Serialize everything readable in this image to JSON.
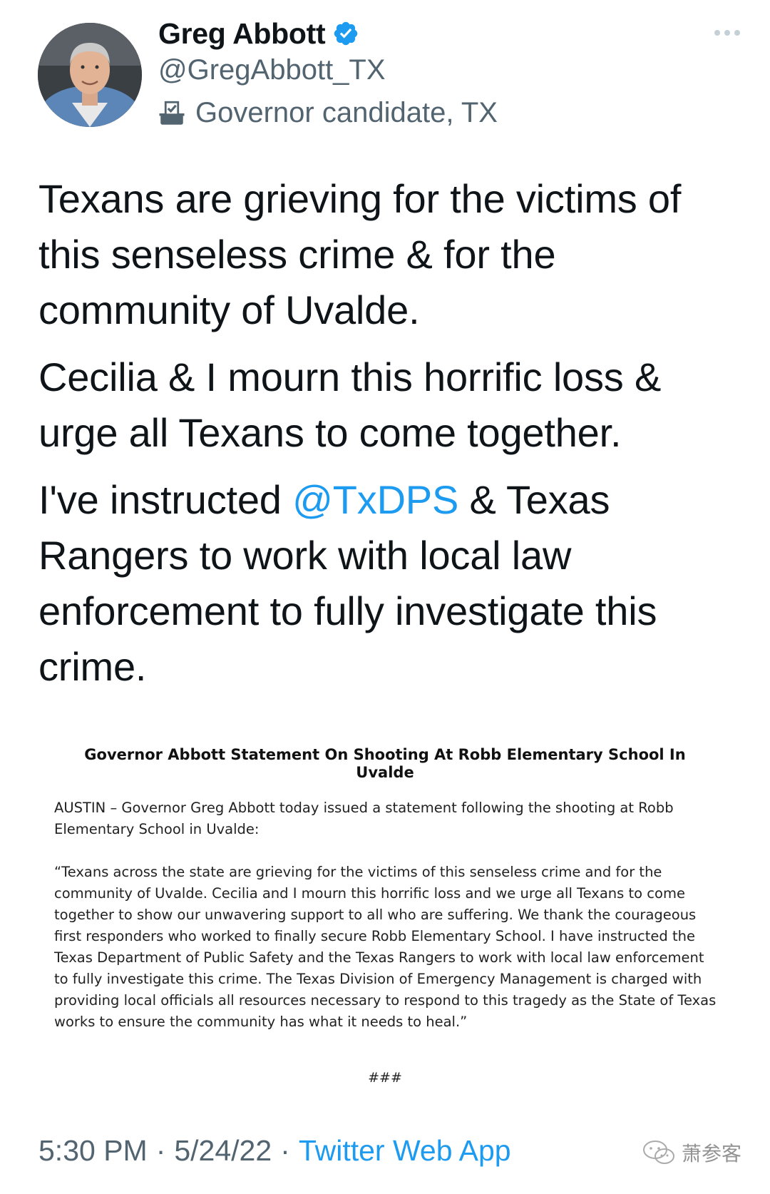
{
  "author": {
    "display_name": "Greg Abbott",
    "handle": "@GregAbbott_TX",
    "label": "Governor candidate, TX",
    "verified_icon": "verified-badge-icon",
    "label_icon": "ballot-box-icon"
  },
  "tweet": {
    "para1": "Texans are grieving for the victims of this senseless crime & for the community of Uvalde.",
    "para2": "Cecilia & I mourn this horrific loss & urge all Texans to come together.",
    "para3_before": "I've instructed ",
    "para3_mention": "@TxDPS",
    "para3_after": " & Texas Rangers to work with local law enforcement to fully investigate this crime."
  },
  "statement": {
    "title": "Governor Abbott Statement On Shooting At Robb Elementary School In Uvalde",
    "intro": "AUSTIN – Governor Greg Abbott today issued a statement following the shooting at Robb Elementary School in Uvalde:",
    "quote": "“Texans across the state are grieving for the victims of this senseless crime and for the community of Uvalde. Cecilia and I mourn this horrific loss and we urge all Texans to come together to show our unwavering support to all who are suffering. We thank the courageous first responders who worked to finally secure Robb Elementary School. I have instructed the Texas Department of Public Safety and the Texas Rangers to work with local law enforcement to fully investigate this crime. The Texas Division of Emergency Management is charged with providing local officials all resources necessary to respond to this tragedy as the State of Texas works to ensure the community has what it needs to heal.”",
    "end_mark": "###"
  },
  "footer": {
    "time": "5:30 PM",
    "separator": "·",
    "date": "5/24/22",
    "source": "Twitter Web App"
  },
  "watermark": {
    "text": "萧参客",
    "icon": "wechat-icon"
  },
  "colors": {
    "accent": "#1d9bf0",
    "secondary_text": "#536471",
    "primary_text": "#0f1419"
  }
}
